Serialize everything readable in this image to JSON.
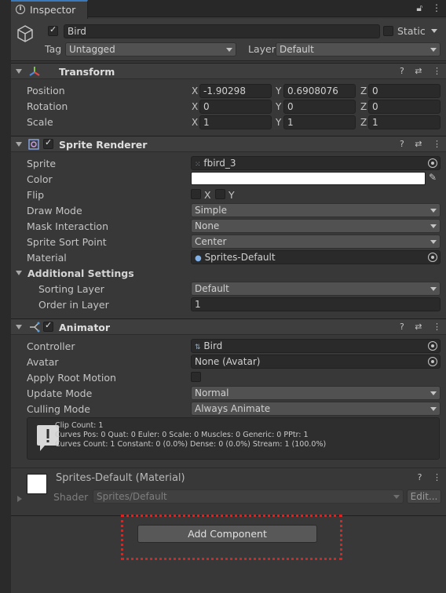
{
  "window": {
    "tab_label": "Inspector",
    "tab_tools": [
      "a",
      "⋮"
    ]
  },
  "game_object": {
    "name": "Bird",
    "active": true,
    "static_label": "Static",
    "tag_label": "Tag",
    "tag_value": "Untagged",
    "layer_label": "Layer",
    "layer_value": "Default"
  },
  "transform": {
    "title": "Transform",
    "position": {
      "label": "Position",
      "x": "-1.90298",
      "y": "0.6908076",
      "z": "0"
    },
    "rotation": {
      "label": "Rotation",
      "x": "0",
      "y": "0",
      "z": "0"
    },
    "scale": {
      "label": "Scale",
      "x": "1",
      "y": "1",
      "z": "1"
    },
    "axis_labels": {
      "x": "X",
      "y": "Y",
      "z": "Z"
    }
  },
  "sprite_renderer": {
    "title": "Sprite Renderer",
    "sprite": {
      "label": "Sprite",
      "value": "fbird_3"
    },
    "color": {
      "label": "Color",
      "value": "#ffffff"
    },
    "flip": {
      "label": "Flip",
      "x": "X",
      "y": "Y"
    },
    "draw_mode": {
      "label": "Draw Mode",
      "value": "Simple"
    },
    "mask_interaction": {
      "label": "Mask Interaction",
      "value": "None"
    },
    "sprite_sort_point": {
      "label": "Sprite Sort Point",
      "value": "Center"
    },
    "material": {
      "label": "Material",
      "value": "Sprites-Default"
    },
    "additional_settings": "Additional Settings",
    "sorting_layer": {
      "label": "Sorting Layer",
      "value": "Default"
    },
    "order_in_layer": {
      "label": "Order in Layer",
      "value": "1"
    }
  },
  "animator": {
    "title": "Animator",
    "controller": {
      "label": "Controller",
      "value": "Bird"
    },
    "avatar": {
      "label": "Avatar",
      "value": "None (Avatar)"
    },
    "apply_root_motion": {
      "label": "Apply Root Motion"
    },
    "update_mode": {
      "label": "Update Mode",
      "value": "Normal"
    },
    "culling_mode": {
      "label": "Culling Mode",
      "value": "Always Animate"
    },
    "info": [
      "Clip Count: 1",
      "Curves Pos: 0 Quat: 0 Euler: 0 Scale: 0 Muscles: 0 Generic: 0 PPtr: 1",
      "Curves Count: 1 Constant: 0 (0.0%) Dense: 0 (0.0%) Stream: 1 (100.0%)"
    ]
  },
  "material_preview": {
    "title": "Sprites-Default (Material)",
    "shader_label": "Shader",
    "shader_value": "Sprites/Default",
    "edit_label": "Edit..."
  },
  "add_component_label": "Add Component",
  "colors": {
    "accent": "#3a79bb",
    "highlight": "#e12020"
  }
}
